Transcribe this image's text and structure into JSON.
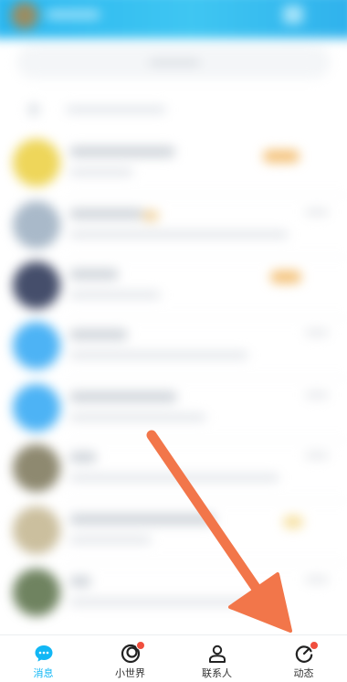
{
  "tabbar": {
    "tabs": [
      {
        "label": "消息",
        "icon": "message-icon",
        "active": true,
        "badge": false
      },
      {
        "label": "小世界",
        "icon": "small-world-icon",
        "active": false,
        "badge": true
      },
      {
        "label": "联系人",
        "icon": "contacts-icon",
        "active": false,
        "badge": false
      },
      {
        "label": "动态",
        "icon": "feed-icon",
        "active": false,
        "badge": true
      }
    ]
  },
  "annotation": {
    "arrow_color": "#f2764a",
    "points_to": "tab-feed"
  },
  "colors": {
    "accent": "#12b7f5",
    "header": "#29b6f0",
    "badge": "#f04f3e"
  }
}
